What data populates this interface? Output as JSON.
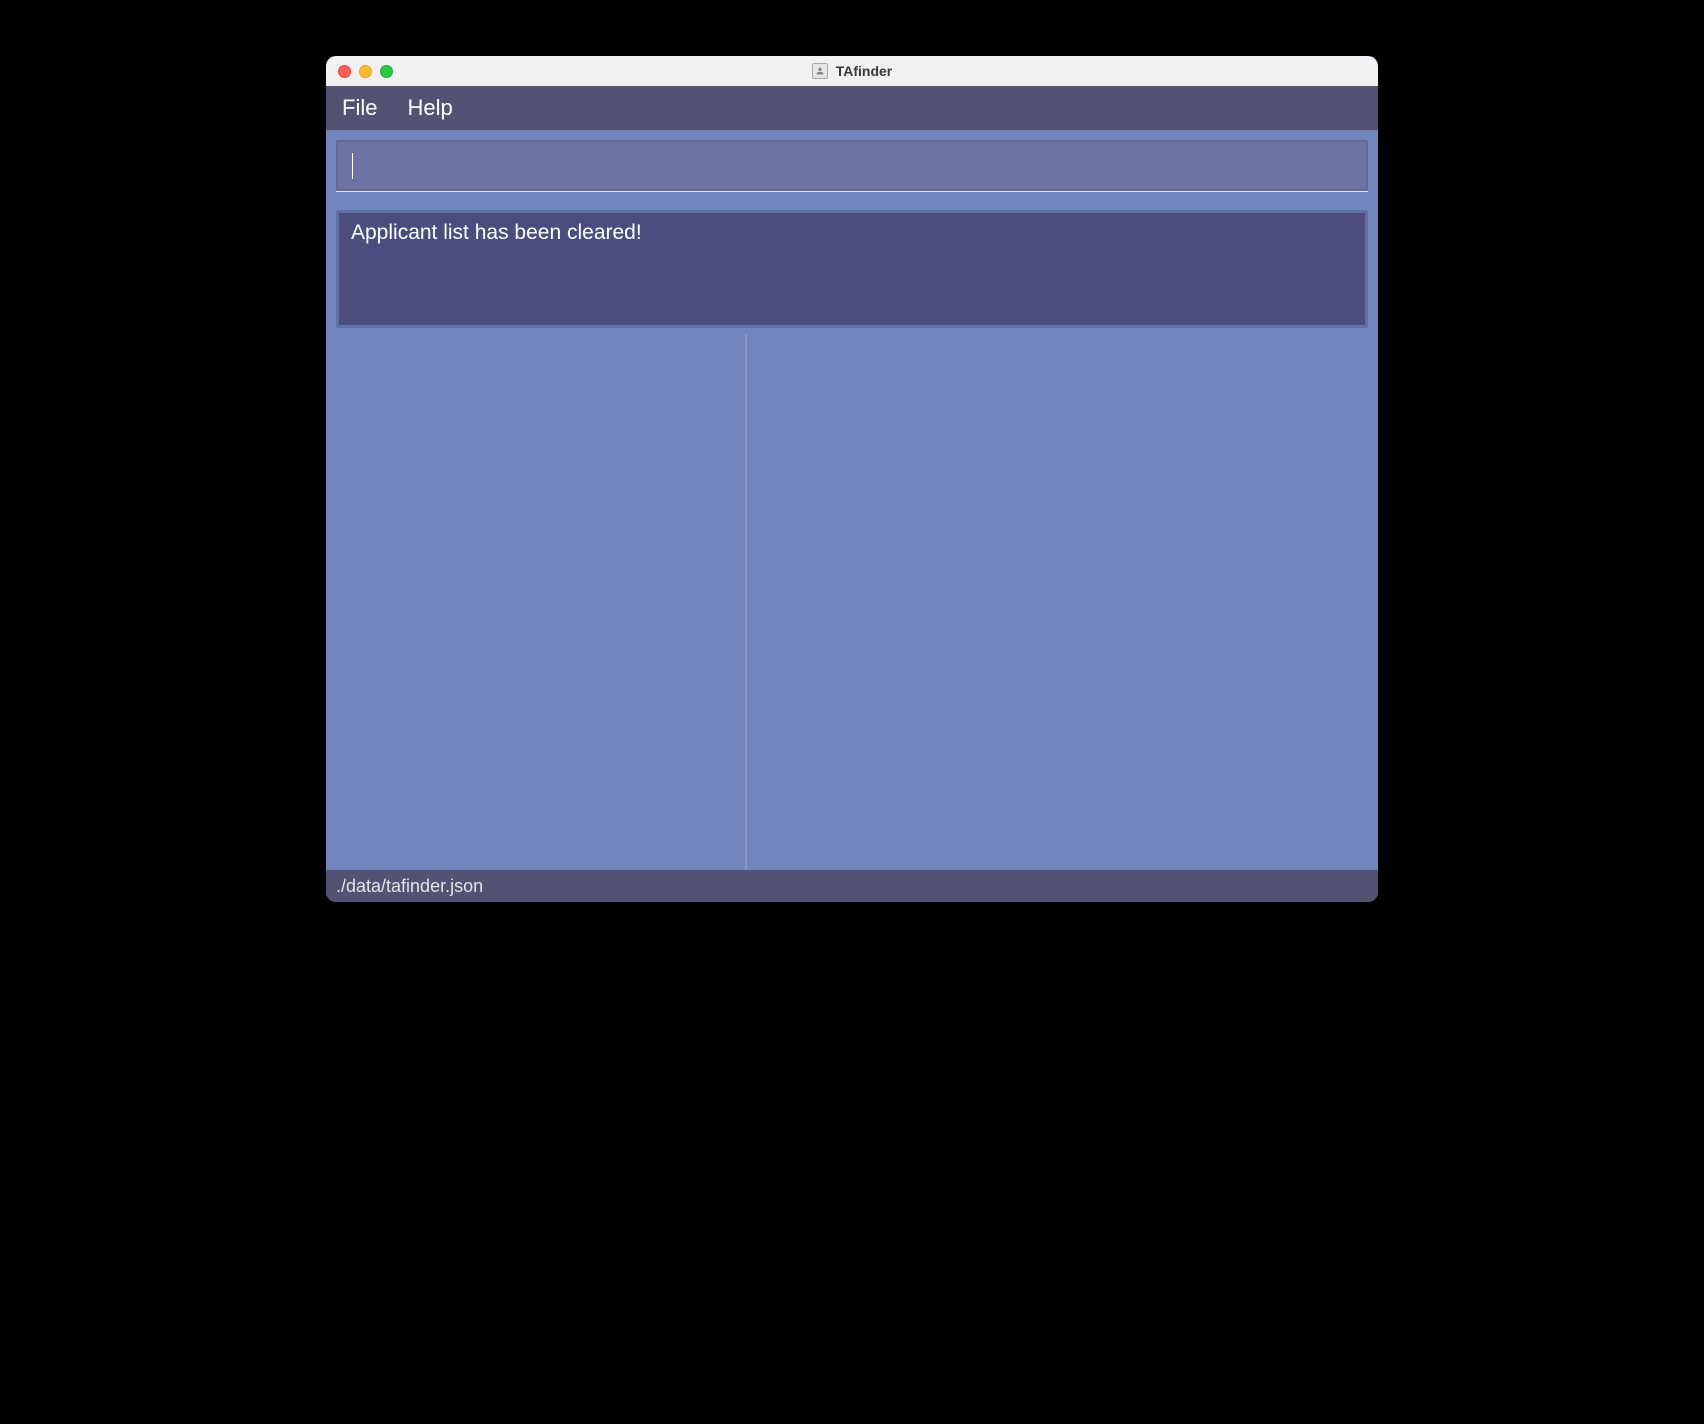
{
  "window": {
    "title": "TAfinder"
  },
  "menu": {
    "file": "File",
    "help": "Help"
  },
  "command": {
    "value": ""
  },
  "result": {
    "message": "Applicant list has been cleared!"
  },
  "status": {
    "path": "./data/tafinder.json"
  }
}
